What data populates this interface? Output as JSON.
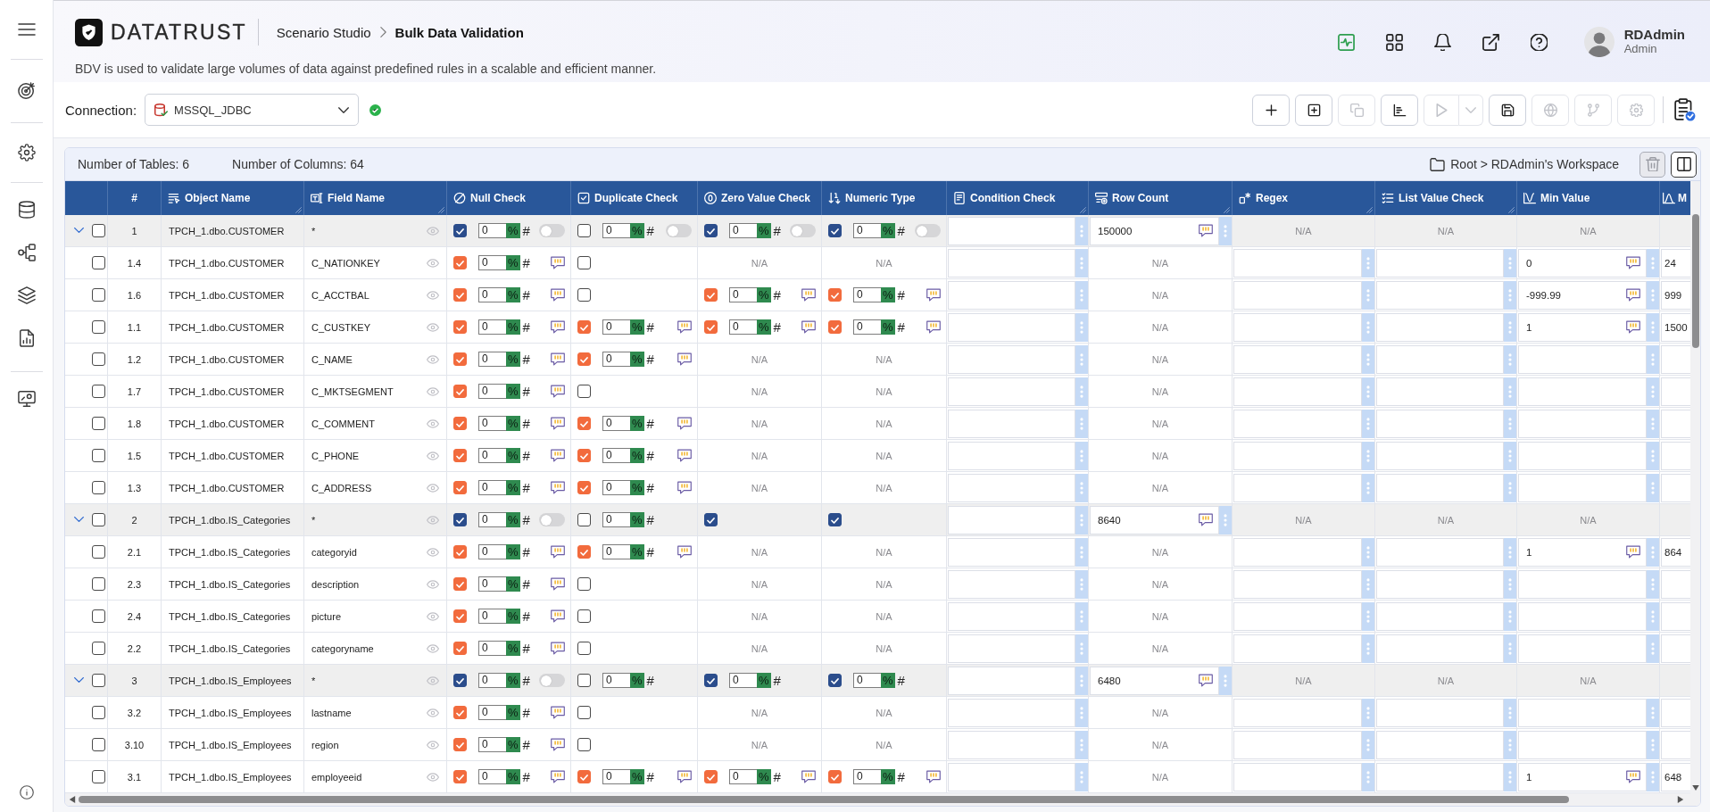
{
  "header": {
    "logo_text": "DATATRUST",
    "breadcrumb": [
      {
        "label": "Scenario Studio",
        "current": false
      },
      {
        "label": "Bulk Data Validation",
        "current": true
      }
    ],
    "description": "BDV is used to validate large volumes of data against predefined rules in a scalable and efficient manner."
  },
  "user": {
    "name": "RDAdmin",
    "role": "Admin"
  },
  "connection": {
    "label": "Connection:",
    "value": "MSSQL_JDBC",
    "connected": true
  },
  "toolbar": [
    {
      "disabled": false
    },
    {
      "disabled": false
    },
    {
      "disabled": true
    },
    {
      "disabled": false
    },
    {
      "disabled": true
    },
    {
      "disabled": false
    },
    {
      "disabled": true
    },
    {
      "disabled": true
    },
    {
      "disabled": true
    }
  ],
  "summary": {
    "tables": "Number of Tables: 6",
    "columns": "Number of Columns: 64",
    "path": "Root > RDAdmin's Workspace",
    "actions": [
      {
        "disabled": true
      },
      {
        "disabled": false
      }
    ]
  },
  "table": {
    "columns": [
      "",
      "#",
      "Object Name",
      "Field Name",
      "Null Check",
      "Duplicate Check",
      "Zero Value Check",
      "Numeric Type",
      "Condition Check",
      "Row Count",
      "Regex",
      "List Value Check",
      "Min Value",
      "M"
    ],
    "rows": [
      {
        "kind": "group",
        "cells": [
          {
            "kind": "select",
            "expanded": true,
            "selected": false
          },
          {
            "kind": "index",
            "text": "1"
          },
          {
            "kind": "text",
            "text": "TPCH_1.dbo.CUSTOMER"
          },
          {
            "kind": "field",
            "text": "*"
          },
          {
            "kind": "check",
            "checked": true,
            "value": "0",
            "units": [
              {
                "label": "%",
                "selected": true
              },
              {
                "label": "#",
                "selected": false
              }
            ],
            "switch_on": false
          },
          {
            "kind": "check",
            "checked": false,
            "value": "0",
            "units": [
              {
                "label": "%",
                "selected": true
              },
              {
                "label": "#",
                "selected": false
              }
            ],
            "switch_on": false
          },
          {
            "kind": "check",
            "checked": true,
            "value": "0",
            "units": [
              {
                "label": "%",
                "selected": true
              },
              {
                "label": "#",
                "selected": false
              }
            ],
            "switch_on": false
          },
          {
            "kind": "check",
            "checked": true,
            "value": "0",
            "units": [
              {
                "label": "%",
                "selected": true
              },
              {
                "label": "#",
                "selected": false
              }
            ],
            "switch_on": false
          },
          {
            "kind": "input"
          },
          {
            "kind": "input",
            "value": "150000",
            "comment": true
          },
          {
            "kind": "na",
            "text": "N/A"
          },
          {
            "kind": "na",
            "text": "N/A"
          },
          {
            "kind": "na",
            "text": "N/A"
          },
          {
            "kind": "blank"
          }
        ]
      },
      {
        "kind": "field",
        "cells": [
          {
            "kind": "select",
            "selected": false
          },
          {
            "kind": "index",
            "text": "1.4"
          },
          {
            "kind": "text",
            "text": "TPCH_1.dbo.CUSTOMER"
          },
          {
            "kind": "field",
            "text": "C_NATIONKEY"
          },
          {
            "kind": "check",
            "checked": true,
            "value": "0",
            "units": [
              {
                "label": "%",
                "selected": true
              },
              {
                "label": "#",
                "selected": false
              }
            ],
            "comment": true
          },
          {
            "kind": "check",
            "checked": false
          },
          {
            "kind": "na",
            "text": "N/A"
          },
          {
            "kind": "na",
            "text": "N/A"
          },
          {
            "kind": "input"
          },
          {
            "kind": "na",
            "text": "N/A"
          },
          {
            "kind": "input"
          },
          {
            "kind": "input"
          },
          {
            "kind": "input",
            "value": "0",
            "comment": true
          },
          {
            "kind": "partial",
            "value": "24"
          }
        ]
      },
      {
        "kind": "field",
        "cells": [
          {
            "kind": "select",
            "selected": false
          },
          {
            "kind": "index",
            "text": "1.6"
          },
          {
            "kind": "text",
            "text": "TPCH_1.dbo.CUSTOMER"
          },
          {
            "kind": "field",
            "text": "C_ACCTBAL"
          },
          {
            "kind": "check",
            "checked": true,
            "value": "0",
            "units": [
              {
                "label": "%",
                "selected": true
              },
              {
                "label": "#",
                "selected": false
              }
            ],
            "comment": true
          },
          {
            "kind": "check",
            "checked": false
          },
          {
            "kind": "check",
            "checked": true,
            "value": "0",
            "units": [
              {
                "label": "%",
                "selected": true
              },
              {
                "label": "#",
                "selected": false
              }
            ],
            "comment": true
          },
          {
            "kind": "check",
            "checked": true,
            "value": "0",
            "units": [
              {
                "label": "%",
                "selected": true
              },
              {
                "label": "#",
                "selected": false
              }
            ],
            "comment": true
          },
          {
            "kind": "input"
          },
          {
            "kind": "na",
            "text": "N/A"
          },
          {
            "kind": "input"
          },
          {
            "kind": "input"
          },
          {
            "kind": "input",
            "value": "-999.99",
            "comment": true
          },
          {
            "kind": "partial",
            "value": "999"
          }
        ]
      },
      {
        "kind": "field",
        "cells": [
          {
            "kind": "select",
            "selected": false
          },
          {
            "kind": "index",
            "text": "1.1"
          },
          {
            "kind": "text",
            "text": "TPCH_1.dbo.CUSTOMER"
          },
          {
            "kind": "field",
            "text": "C_CUSTKEY"
          },
          {
            "kind": "check",
            "checked": true,
            "value": "0",
            "units": [
              {
                "label": "%",
                "selected": true
              },
              {
                "label": "#",
                "selected": false
              }
            ],
            "comment": true
          },
          {
            "kind": "check",
            "checked": true,
            "value": "0",
            "units": [
              {
                "label": "%",
                "selected": true
              },
              {
                "label": "#",
                "selected": false
              }
            ],
            "comment": true
          },
          {
            "kind": "check",
            "checked": true,
            "value": "0",
            "units": [
              {
                "label": "%",
                "selected": true
              },
              {
                "label": "#",
                "selected": false
              }
            ],
            "comment": true
          },
          {
            "kind": "check",
            "checked": true,
            "value": "0",
            "units": [
              {
                "label": "%",
                "selected": true
              },
              {
                "label": "#",
                "selected": false
              }
            ],
            "comment": true
          },
          {
            "kind": "input"
          },
          {
            "kind": "na",
            "text": "N/A"
          },
          {
            "kind": "input"
          },
          {
            "kind": "input"
          },
          {
            "kind": "input",
            "value": "1",
            "comment": true
          },
          {
            "kind": "partial",
            "value": "1500"
          }
        ]
      },
      {
        "kind": "field",
        "cells": [
          {
            "kind": "select",
            "selected": false
          },
          {
            "kind": "index",
            "text": "1.2"
          },
          {
            "kind": "text",
            "text": "TPCH_1.dbo.CUSTOMER"
          },
          {
            "kind": "field",
            "text": "C_NAME"
          },
          {
            "kind": "check",
            "checked": true,
            "value": "0",
            "units": [
              {
                "label": "%",
                "selected": true
              },
              {
                "label": "#",
                "selected": false
              }
            ],
            "comment": true
          },
          {
            "kind": "check",
            "checked": true,
            "value": "0",
            "units": [
              {
                "label": "%",
                "selected": true
              },
              {
                "label": "#",
                "selected": false
              }
            ],
            "comment": true
          },
          {
            "kind": "na",
            "text": "N/A"
          },
          {
            "kind": "na",
            "text": "N/A"
          },
          {
            "kind": "input"
          },
          {
            "kind": "na",
            "text": "N/A"
          },
          {
            "kind": "input"
          },
          {
            "kind": "input"
          },
          {
            "kind": "input"
          },
          {
            "kind": "partial"
          }
        ]
      },
      {
        "kind": "field",
        "cells": [
          {
            "kind": "select",
            "selected": false
          },
          {
            "kind": "index",
            "text": "1.7"
          },
          {
            "kind": "text",
            "text": "TPCH_1.dbo.CUSTOMER"
          },
          {
            "kind": "field",
            "text": "C_MKTSEGMENT"
          },
          {
            "kind": "check",
            "checked": true,
            "value": "0",
            "units": [
              {
                "label": "%",
                "selected": true
              },
              {
                "label": "#",
                "selected": false
              }
            ],
            "comment": true
          },
          {
            "kind": "check",
            "checked": false
          },
          {
            "kind": "na",
            "text": "N/A"
          },
          {
            "kind": "na",
            "text": "N/A"
          },
          {
            "kind": "input"
          },
          {
            "kind": "na",
            "text": "N/A"
          },
          {
            "kind": "input"
          },
          {
            "kind": "input"
          },
          {
            "kind": "input"
          },
          {
            "kind": "partial"
          }
        ]
      },
      {
        "kind": "field",
        "cells": [
          {
            "kind": "select",
            "selected": false
          },
          {
            "kind": "index",
            "text": "1.8"
          },
          {
            "kind": "text",
            "text": "TPCH_1.dbo.CUSTOMER"
          },
          {
            "kind": "field",
            "text": "C_COMMENT"
          },
          {
            "kind": "check",
            "checked": true,
            "value": "0",
            "units": [
              {
                "label": "%",
                "selected": true
              },
              {
                "label": "#",
                "selected": false
              }
            ],
            "comment": true
          },
          {
            "kind": "check",
            "checked": true,
            "value": "0",
            "units": [
              {
                "label": "%",
                "selected": true
              },
              {
                "label": "#",
                "selected": false
              }
            ],
            "comment": true
          },
          {
            "kind": "na",
            "text": "N/A"
          },
          {
            "kind": "na",
            "text": "N/A"
          },
          {
            "kind": "input"
          },
          {
            "kind": "na",
            "text": "N/A"
          },
          {
            "kind": "input"
          },
          {
            "kind": "input"
          },
          {
            "kind": "input"
          },
          {
            "kind": "partial"
          }
        ]
      },
      {
        "kind": "field",
        "cells": [
          {
            "kind": "select",
            "selected": false
          },
          {
            "kind": "index",
            "text": "1.5"
          },
          {
            "kind": "text",
            "text": "TPCH_1.dbo.CUSTOMER"
          },
          {
            "kind": "field",
            "text": "C_PHONE"
          },
          {
            "kind": "check",
            "checked": true,
            "value": "0",
            "units": [
              {
                "label": "%",
                "selected": true
              },
              {
                "label": "#",
                "selected": false
              }
            ],
            "comment": true
          },
          {
            "kind": "check",
            "checked": true,
            "value": "0",
            "units": [
              {
                "label": "%",
                "selected": true
              },
              {
                "label": "#",
                "selected": false
              }
            ],
            "comment": true
          },
          {
            "kind": "na",
            "text": "N/A"
          },
          {
            "kind": "na",
            "text": "N/A"
          },
          {
            "kind": "input"
          },
          {
            "kind": "na",
            "text": "N/A"
          },
          {
            "kind": "input"
          },
          {
            "kind": "input"
          },
          {
            "kind": "input"
          },
          {
            "kind": "partial"
          }
        ]
      },
      {
        "kind": "field",
        "cells": [
          {
            "kind": "select",
            "selected": false
          },
          {
            "kind": "index",
            "text": "1.3"
          },
          {
            "kind": "text",
            "text": "TPCH_1.dbo.CUSTOMER"
          },
          {
            "kind": "field",
            "text": "C_ADDRESS"
          },
          {
            "kind": "check",
            "checked": true,
            "value": "0",
            "units": [
              {
                "label": "%",
                "selected": true
              },
              {
                "label": "#",
                "selected": false
              }
            ],
            "comment": true
          },
          {
            "kind": "check",
            "checked": true,
            "value": "0",
            "units": [
              {
                "label": "%",
                "selected": true
              },
              {
                "label": "#",
                "selected": false
              }
            ],
            "comment": true
          },
          {
            "kind": "na",
            "text": "N/A"
          },
          {
            "kind": "na",
            "text": "N/A"
          },
          {
            "kind": "input"
          },
          {
            "kind": "na",
            "text": "N/A"
          },
          {
            "kind": "input"
          },
          {
            "kind": "input"
          },
          {
            "kind": "input"
          },
          {
            "kind": "partial"
          }
        ]
      },
      {
        "kind": "group",
        "cells": [
          {
            "kind": "select",
            "expanded": true,
            "selected": false
          },
          {
            "kind": "index",
            "text": "2"
          },
          {
            "kind": "text",
            "text": "TPCH_1.dbo.IS_Categories"
          },
          {
            "kind": "field",
            "text": "*"
          },
          {
            "kind": "check",
            "checked": true,
            "value": "0",
            "units": [
              {
                "label": "%",
                "selected": true
              },
              {
                "label": "#",
                "selected": false
              }
            ],
            "switch_on": false
          },
          {
            "kind": "check",
            "checked": false,
            "value": "0",
            "units": [
              {
                "label": "%",
                "selected": true
              },
              {
                "label": "#",
                "selected": false
              }
            ]
          },
          {
            "kind": "check",
            "checked": true
          },
          {
            "kind": "check",
            "checked": true
          },
          {
            "kind": "input"
          },
          {
            "kind": "input",
            "value": "8640",
            "comment": true
          },
          {
            "kind": "na",
            "text": "N/A"
          },
          {
            "kind": "na",
            "text": "N/A"
          },
          {
            "kind": "na",
            "text": "N/A"
          },
          {
            "kind": "blank"
          }
        ]
      },
      {
        "kind": "field",
        "cells": [
          {
            "kind": "select",
            "selected": false
          },
          {
            "kind": "index",
            "text": "2.1"
          },
          {
            "kind": "text",
            "text": "TPCH_1.dbo.IS_Categories"
          },
          {
            "kind": "field",
            "text": "categoryid"
          },
          {
            "kind": "check",
            "checked": true,
            "value": "0",
            "units": [
              {
                "label": "%",
                "selected": true
              },
              {
                "label": "#",
                "selected": false
              }
            ],
            "comment": true
          },
          {
            "kind": "check",
            "checked": true,
            "value": "0",
            "units": [
              {
                "label": "%",
                "selected": true
              },
              {
                "label": "#",
                "selected": false
              }
            ],
            "comment": true
          },
          {
            "kind": "na",
            "text": "N/A"
          },
          {
            "kind": "na",
            "text": "N/A"
          },
          {
            "kind": "input"
          },
          {
            "kind": "na",
            "text": "N/A"
          },
          {
            "kind": "input"
          },
          {
            "kind": "input"
          },
          {
            "kind": "input",
            "value": "1",
            "comment": true
          },
          {
            "kind": "partial",
            "value": "864"
          }
        ]
      },
      {
        "kind": "field",
        "cells": [
          {
            "kind": "select",
            "selected": false
          },
          {
            "kind": "index",
            "text": "2.3"
          },
          {
            "kind": "text",
            "text": "TPCH_1.dbo.IS_Categories"
          },
          {
            "kind": "field",
            "text": "description"
          },
          {
            "kind": "check",
            "checked": true,
            "value": "0",
            "units": [
              {
                "label": "%",
                "selected": true
              },
              {
                "label": "#",
                "selected": false
              }
            ],
            "comment": true
          },
          {
            "kind": "check",
            "checked": false
          },
          {
            "kind": "na",
            "text": "N/A"
          },
          {
            "kind": "na",
            "text": "N/A"
          },
          {
            "kind": "input"
          },
          {
            "kind": "na",
            "text": "N/A"
          },
          {
            "kind": "input"
          },
          {
            "kind": "input"
          },
          {
            "kind": "input"
          },
          {
            "kind": "partial"
          }
        ]
      },
      {
        "kind": "field",
        "cells": [
          {
            "kind": "select",
            "selected": false
          },
          {
            "kind": "index",
            "text": "2.4"
          },
          {
            "kind": "text",
            "text": "TPCH_1.dbo.IS_Categories"
          },
          {
            "kind": "field",
            "text": "picture"
          },
          {
            "kind": "check",
            "checked": true,
            "value": "0",
            "units": [
              {
                "label": "%",
                "selected": true
              },
              {
                "label": "#",
                "selected": false
              }
            ],
            "comment": true
          },
          {
            "kind": "check",
            "checked": false
          },
          {
            "kind": "na",
            "text": "N/A"
          },
          {
            "kind": "na",
            "text": "N/A"
          },
          {
            "kind": "input"
          },
          {
            "kind": "na",
            "text": "N/A"
          },
          {
            "kind": "input"
          },
          {
            "kind": "input"
          },
          {
            "kind": "input"
          },
          {
            "kind": "partial"
          }
        ]
      },
      {
        "kind": "field",
        "cells": [
          {
            "kind": "select",
            "selected": false
          },
          {
            "kind": "index",
            "text": "2.2"
          },
          {
            "kind": "text",
            "text": "TPCH_1.dbo.IS_Categories"
          },
          {
            "kind": "field",
            "text": "categoryname"
          },
          {
            "kind": "check",
            "checked": true,
            "value": "0",
            "units": [
              {
                "label": "%",
                "selected": true
              },
              {
                "label": "#",
                "selected": false
              }
            ],
            "comment": true
          },
          {
            "kind": "check",
            "checked": false
          },
          {
            "kind": "na",
            "text": "N/A"
          },
          {
            "kind": "na",
            "text": "N/A"
          },
          {
            "kind": "input"
          },
          {
            "kind": "na",
            "text": "N/A"
          },
          {
            "kind": "input"
          },
          {
            "kind": "input"
          },
          {
            "kind": "input"
          },
          {
            "kind": "partial"
          }
        ]
      },
      {
        "kind": "group",
        "cells": [
          {
            "kind": "select",
            "expanded": true,
            "selected": false
          },
          {
            "kind": "index",
            "text": "3"
          },
          {
            "kind": "text",
            "text": "TPCH_1.dbo.IS_Employees"
          },
          {
            "kind": "field",
            "text": "*"
          },
          {
            "kind": "check",
            "checked": true,
            "value": "0",
            "units": [
              {
                "label": "%",
                "selected": true
              },
              {
                "label": "#",
                "selected": false
              }
            ],
            "switch_on": false
          },
          {
            "kind": "check",
            "checked": false,
            "value": "0",
            "units": [
              {
                "label": "%",
                "selected": true
              },
              {
                "label": "#",
                "selected": false
              }
            ]
          },
          {
            "kind": "check",
            "checked": true,
            "value": "0",
            "units": [
              {
                "label": "%",
                "selected": true
              },
              {
                "label": "#",
                "selected": false
              }
            ]
          },
          {
            "kind": "check",
            "checked": true,
            "value": "0",
            "units": [
              {
                "label": "%",
                "selected": true
              },
              {
                "label": "#",
                "selected": false
              }
            ]
          },
          {
            "kind": "input"
          },
          {
            "kind": "input",
            "value": "6480",
            "comment": true
          },
          {
            "kind": "na",
            "text": "N/A"
          },
          {
            "kind": "na",
            "text": "N/A"
          },
          {
            "kind": "na",
            "text": "N/A"
          },
          {
            "kind": "blank"
          }
        ]
      },
      {
        "kind": "field",
        "cells": [
          {
            "kind": "select",
            "selected": false
          },
          {
            "kind": "index",
            "text": "3.2"
          },
          {
            "kind": "text",
            "text": "TPCH_1.dbo.IS_Employees"
          },
          {
            "kind": "field",
            "text": "lastname"
          },
          {
            "kind": "check",
            "checked": true,
            "value": "0",
            "units": [
              {
                "label": "%",
                "selected": true
              },
              {
                "label": "#",
                "selected": false
              }
            ],
            "comment": true
          },
          {
            "kind": "check",
            "checked": false
          },
          {
            "kind": "na",
            "text": "N/A"
          },
          {
            "kind": "na",
            "text": "N/A"
          },
          {
            "kind": "input"
          },
          {
            "kind": "na",
            "text": "N/A"
          },
          {
            "kind": "input"
          },
          {
            "kind": "input"
          },
          {
            "kind": "input"
          },
          {
            "kind": "partial"
          }
        ]
      },
      {
        "kind": "field",
        "cells": [
          {
            "kind": "select",
            "selected": false
          },
          {
            "kind": "index",
            "text": "3.10"
          },
          {
            "kind": "text",
            "text": "TPCH_1.dbo.IS_Employees"
          },
          {
            "kind": "field",
            "text": "region"
          },
          {
            "kind": "check",
            "checked": true,
            "value": "0",
            "units": [
              {
                "label": "%",
                "selected": true
              },
              {
                "label": "#",
                "selected": false
              }
            ],
            "comment": true
          },
          {
            "kind": "check",
            "checked": false
          },
          {
            "kind": "na",
            "text": "N/A"
          },
          {
            "kind": "na",
            "text": "N/A"
          },
          {
            "kind": "input"
          },
          {
            "kind": "na",
            "text": "N/A"
          },
          {
            "kind": "input"
          },
          {
            "kind": "input"
          },
          {
            "kind": "input"
          },
          {
            "kind": "partial"
          }
        ]
      },
      {
        "kind": "field",
        "cells": [
          {
            "kind": "select",
            "selected": false
          },
          {
            "kind": "index",
            "text": "3.1"
          },
          {
            "kind": "text",
            "text": "TPCH_1.dbo.IS_Employees"
          },
          {
            "kind": "field",
            "text": "employeeid"
          },
          {
            "kind": "check",
            "checked": true,
            "value": "0",
            "units": [
              {
                "label": "%",
                "selected": true
              },
              {
                "label": "#",
                "selected": false
              }
            ],
            "comment": true
          },
          {
            "kind": "check",
            "checked": true,
            "value": "0",
            "units": [
              {
                "label": "%",
                "selected": true
              },
              {
                "label": "#",
                "selected": false
              }
            ],
            "comment": true
          },
          {
            "kind": "check",
            "checked": true,
            "value": "0",
            "units": [
              {
                "label": "%",
                "selected": true
              },
              {
                "label": "#",
                "selected": false
              }
            ],
            "comment": true
          },
          {
            "kind": "check",
            "checked": true,
            "value": "0",
            "units": [
              {
                "label": "%",
                "selected": true
              },
              {
                "label": "#",
                "selected": false
              }
            ],
            "comment": true
          },
          {
            "kind": "input"
          },
          {
            "kind": "na",
            "text": "N/A"
          },
          {
            "kind": "input"
          },
          {
            "kind": "input"
          },
          {
            "kind": "input",
            "value": "1",
            "comment": true
          },
          {
            "kind": "partial",
            "value": "648"
          }
        ]
      }
    ]
  }
}
